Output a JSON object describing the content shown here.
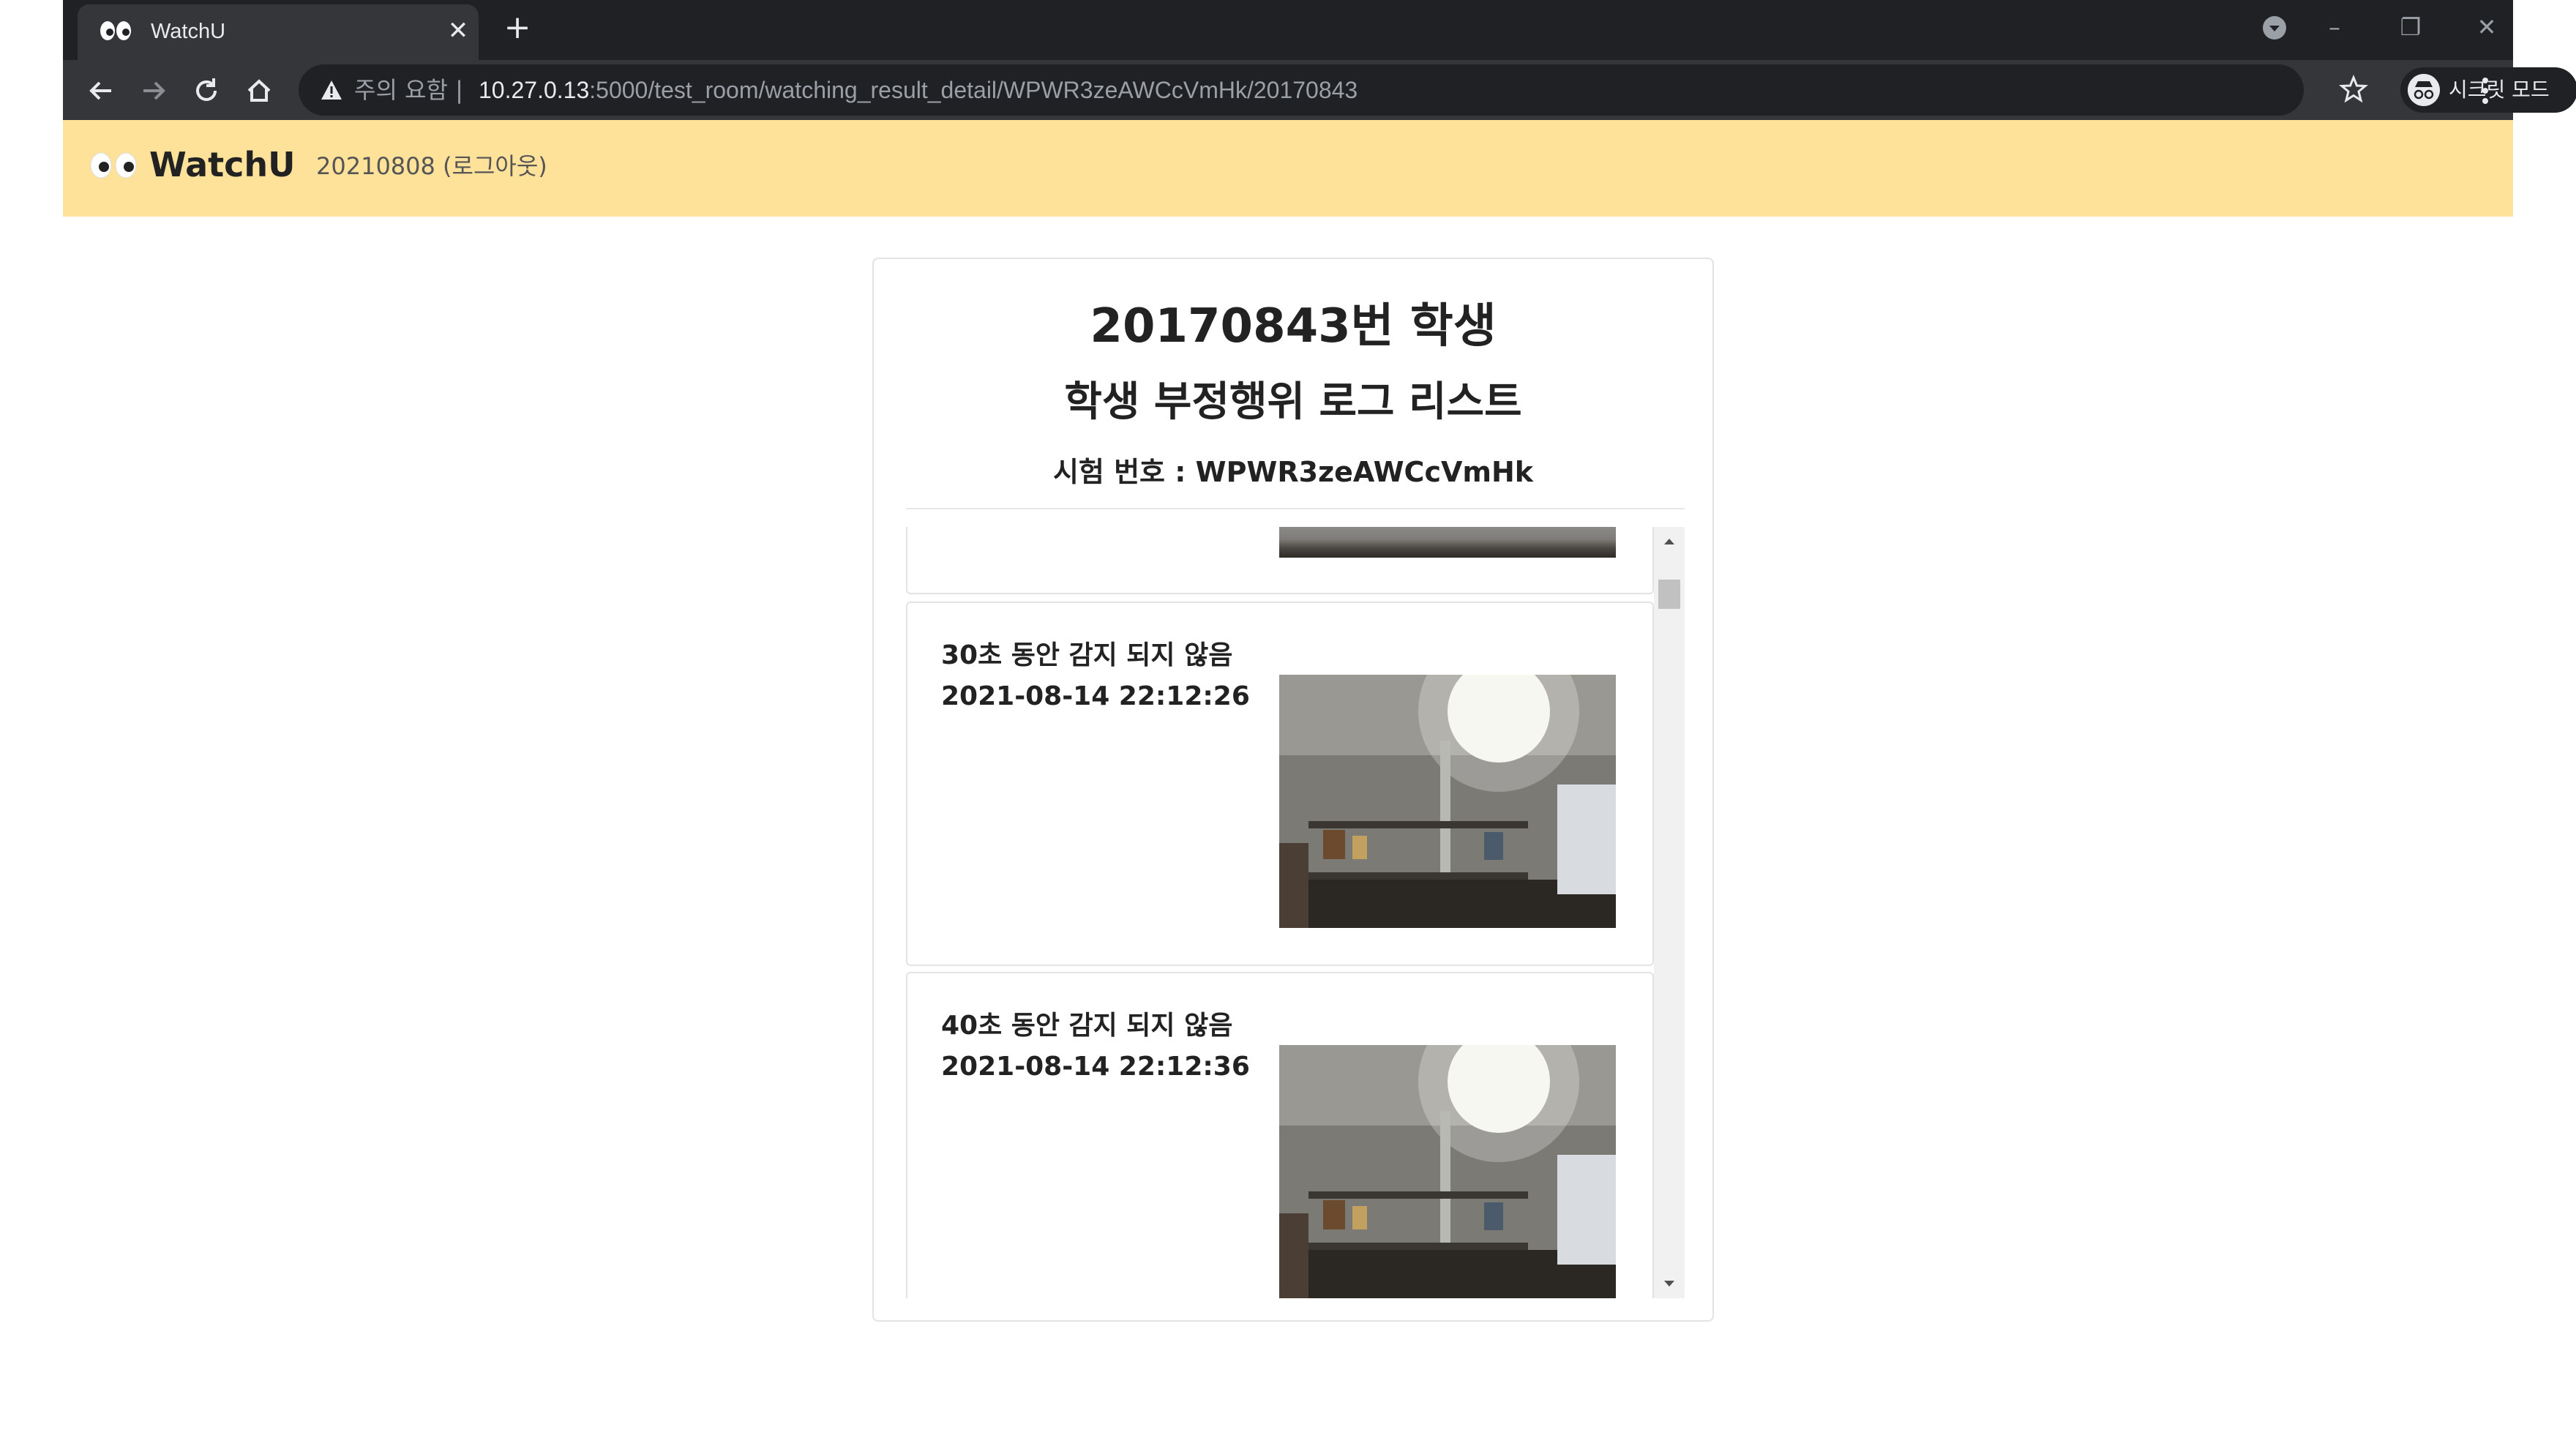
{
  "browser": {
    "tab_title": "WatchU",
    "tab_close": "✕",
    "new_tab": "+",
    "security_label": "주의 요함 |",
    "url_host": "10.27.0.13",
    "url_path": ":5000/test_room/watching_result_detail/WPWR3zeAWCcVmHk/20170843",
    "incognito_label": "시크릿 모드",
    "window_controls": {
      "minimize": "–",
      "restore": "❐",
      "close": "✕"
    }
  },
  "app": {
    "brand": "WatchU",
    "user_link": "20210808 (로그아웃)"
  },
  "card": {
    "student_heading": "20170843번 학생",
    "list_heading": "학생 부정행위 로그 리스트",
    "exam_label": "시험 번호 : WPWR3zeAWCcVmHk"
  },
  "logs": [
    {
      "message": "",
      "time": ""
    },
    {
      "message": "30초 동안 감지 되지 않음",
      "time": "2021-08-14 22:12:26"
    },
    {
      "message": "40초 동안 감지 되지 않음",
      "time": "2021-08-14 22:12:36"
    }
  ],
  "scrollbar": {
    "up": "▲",
    "down": "▼"
  }
}
